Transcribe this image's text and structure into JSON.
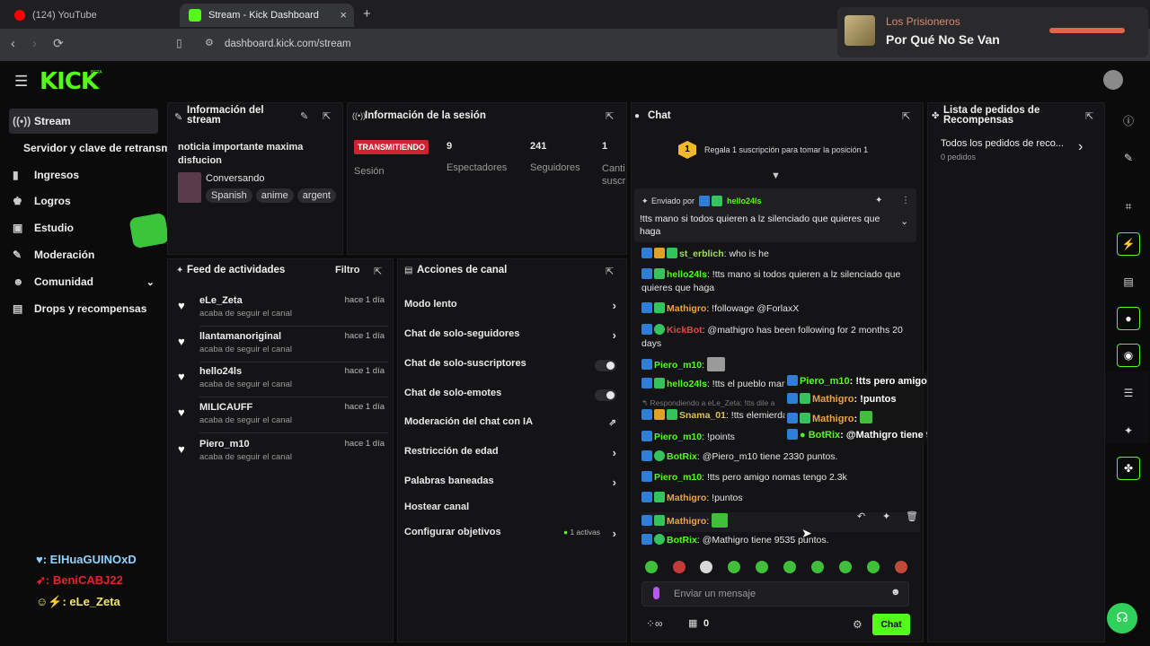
{
  "browser": {
    "tabs": [
      {
        "title": "(124) YouTube"
      },
      {
        "title": "Stream - Kick Dashboard"
      }
    ],
    "new_tab": "+",
    "close": "×",
    "url": "dashboard.kick.com/stream"
  },
  "media": {
    "artist": "Los Prisioneros",
    "track": "Por Qué No Se Van"
  },
  "app": {
    "logo": "KICK",
    "logo_beta": "BETA"
  },
  "sidebar": {
    "items": [
      {
        "label": "Stream",
        "icon": "broadcast-icon"
      },
      {
        "label": "Servidor y clave de retransm",
        "icon": ""
      },
      {
        "label": "Ingresos",
        "icon": "chart-icon"
      },
      {
        "label": "Logros",
        "icon": "trophy-icon"
      },
      {
        "label": "Estudio",
        "icon": "studio-icon"
      },
      {
        "label": "Moderación",
        "icon": "wrench-icon"
      },
      {
        "label": "Comunidad",
        "icon": "people-icon"
      },
      {
        "label": "Drops y recompensas",
        "icon": "gift-icon"
      }
    ]
  },
  "stream_info": {
    "title": "Información del stream",
    "stream_title": "noticia importante maxima disfucion",
    "category": "Conversando",
    "tags": [
      "Spanish",
      "anime",
      "argent"
    ]
  },
  "session": {
    "title": "Información de la sesión",
    "status": "TRANSMITIENDO",
    "status_label": "Sesión",
    "viewers": "9",
    "viewers_label": "Espectadores",
    "followers": "241",
    "followers_label": "Seguidores",
    "subs": "1",
    "subs_label": "Canti suscr"
  },
  "feed": {
    "title": "Feed de actividades",
    "filter": "Filtro",
    "items": [
      {
        "name": "eLe_Zeta",
        "sub": "acaba de seguir el canal",
        "time": "hace 1 día"
      },
      {
        "name": "llantamanoriginal",
        "sub": "acaba de seguir el canal",
        "time": "hace 1 día"
      },
      {
        "name": "hello24ls",
        "sub": "acaba de seguir el canal",
        "time": "hace 1 día"
      },
      {
        "name": "MILICAUFF",
        "sub": "acaba de seguir el canal",
        "time": "hace 1 día"
      },
      {
        "name": "Piero_m10",
        "sub": "acaba de seguir el canal",
        "time": "hace 1 día"
      }
    ]
  },
  "actions": {
    "title": "Acciones de canal",
    "items": [
      {
        "label": "Modo lento"
      },
      {
        "label": "Chat de solo-seguidores"
      },
      {
        "label": "Chat de solo-suscriptores"
      },
      {
        "label": "Chat de solo-emotes"
      },
      {
        "label": "Moderación del chat con IA"
      },
      {
        "label": "Restricción de edad"
      },
      {
        "label": "Palabras baneadas"
      },
      {
        "label": "Hostear canal"
      },
      {
        "label": "Configurar objetivos",
        "extra": "1 activas"
      }
    ]
  },
  "chat": {
    "title": "Chat",
    "gift_rank": "1",
    "gift_text": "Regala 1 suscripción para tomar la posición 1",
    "pinned": {
      "by_label": "Enviado por",
      "user": "hello24ls",
      "text": "!tts mano si todos quieren a lz silenciado que quieres que haga"
    },
    "messages": [
      {
        "user": "st_erblich",
        "color": "#a4de5d",
        "text": "who is he"
      },
      {
        "user": "hello24ls",
        "color": "#53fc18",
        "text": "!tts mano si todos quieren a lz silenciado que quieres que haga"
      },
      {
        "user": "Mathigro",
        "color": "#f0a33a",
        "text": "!followage @ForlaxX"
      },
      {
        "user": "KickBot",
        "color": "#e0484a",
        "text": "@mathigro has been following for 2 months 20 days"
      },
      {
        "user": "Piero_m10",
        "color": "#53fc18",
        "text": ""
      },
      {
        "user": "hello24ls",
        "color": "#53fc18",
        "text": "!tts el pueblo mand"
      },
      {
        "reply": "Respondiendo a eLe_Zeta: !tts dile a"
      },
      {
        "user": "Snama_01",
        "color": "#e0c24a",
        "text": "!tts elemierda"
      },
      {
        "user": "Piero_m10",
        "color": "#53fc18",
        "text": "!points"
      },
      {
        "user": "BotRix",
        "color": "#53fc18",
        "text": "@Piero_m10 tiene 2330 puntos."
      },
      {
        "user": "Piero_m10",
        "color": "#53fc18",
        "text": "!tts pero amigo nomas tengo 2.3k"
      },
      {
        "user": "Mathigro",
        "color": "#f0a33a",
        "text": "!puntos"
      },
      {
        "user": "Mathigro",
        "color": "#f0a33a",
        "text": ""
      },
      {
        "user": "BotRix",
        "color": "#53fc18",
        "text": "@Mathigro tiene 9535 puntos."
      }
    ],
    "input_placeholder": "Enviar un mensaje",
    "points": "0",
    "send_label": "Chat"
  },
  "overlay_chat": [
    {
      "user": "Piero_m10",
      "text": ": !tts pero amigo nomas tengo 2.3k"
    },
    {
      "user": "Mathigro",
      "text": ": !puntos"
    },
    {
      "user": "Mathigro",
      "text": ":"
    },
    {
      "user": "BotRix",
      "text": ": @Mathigro tiene 9535 puntos.",
      "mention": "@Mathigro"
    }
  ],
  "rewards": {
    "title": "Lista de pedidos de Recompensas",
    "all": "Todos los pedidos de reco...",
    "count": "0 pedidos"
  },
  "credits": [
    {
      "text": ": ElHuaGUINOxD",
      "color": "#8fd3ff"
    },
    {
      "text": ": BeniCABJ22",
      "color": "#e0262b"
    },
    {
      "text": ": eLe_Zeta",
      "color": "#f5e66a"
    }
  ]
}
